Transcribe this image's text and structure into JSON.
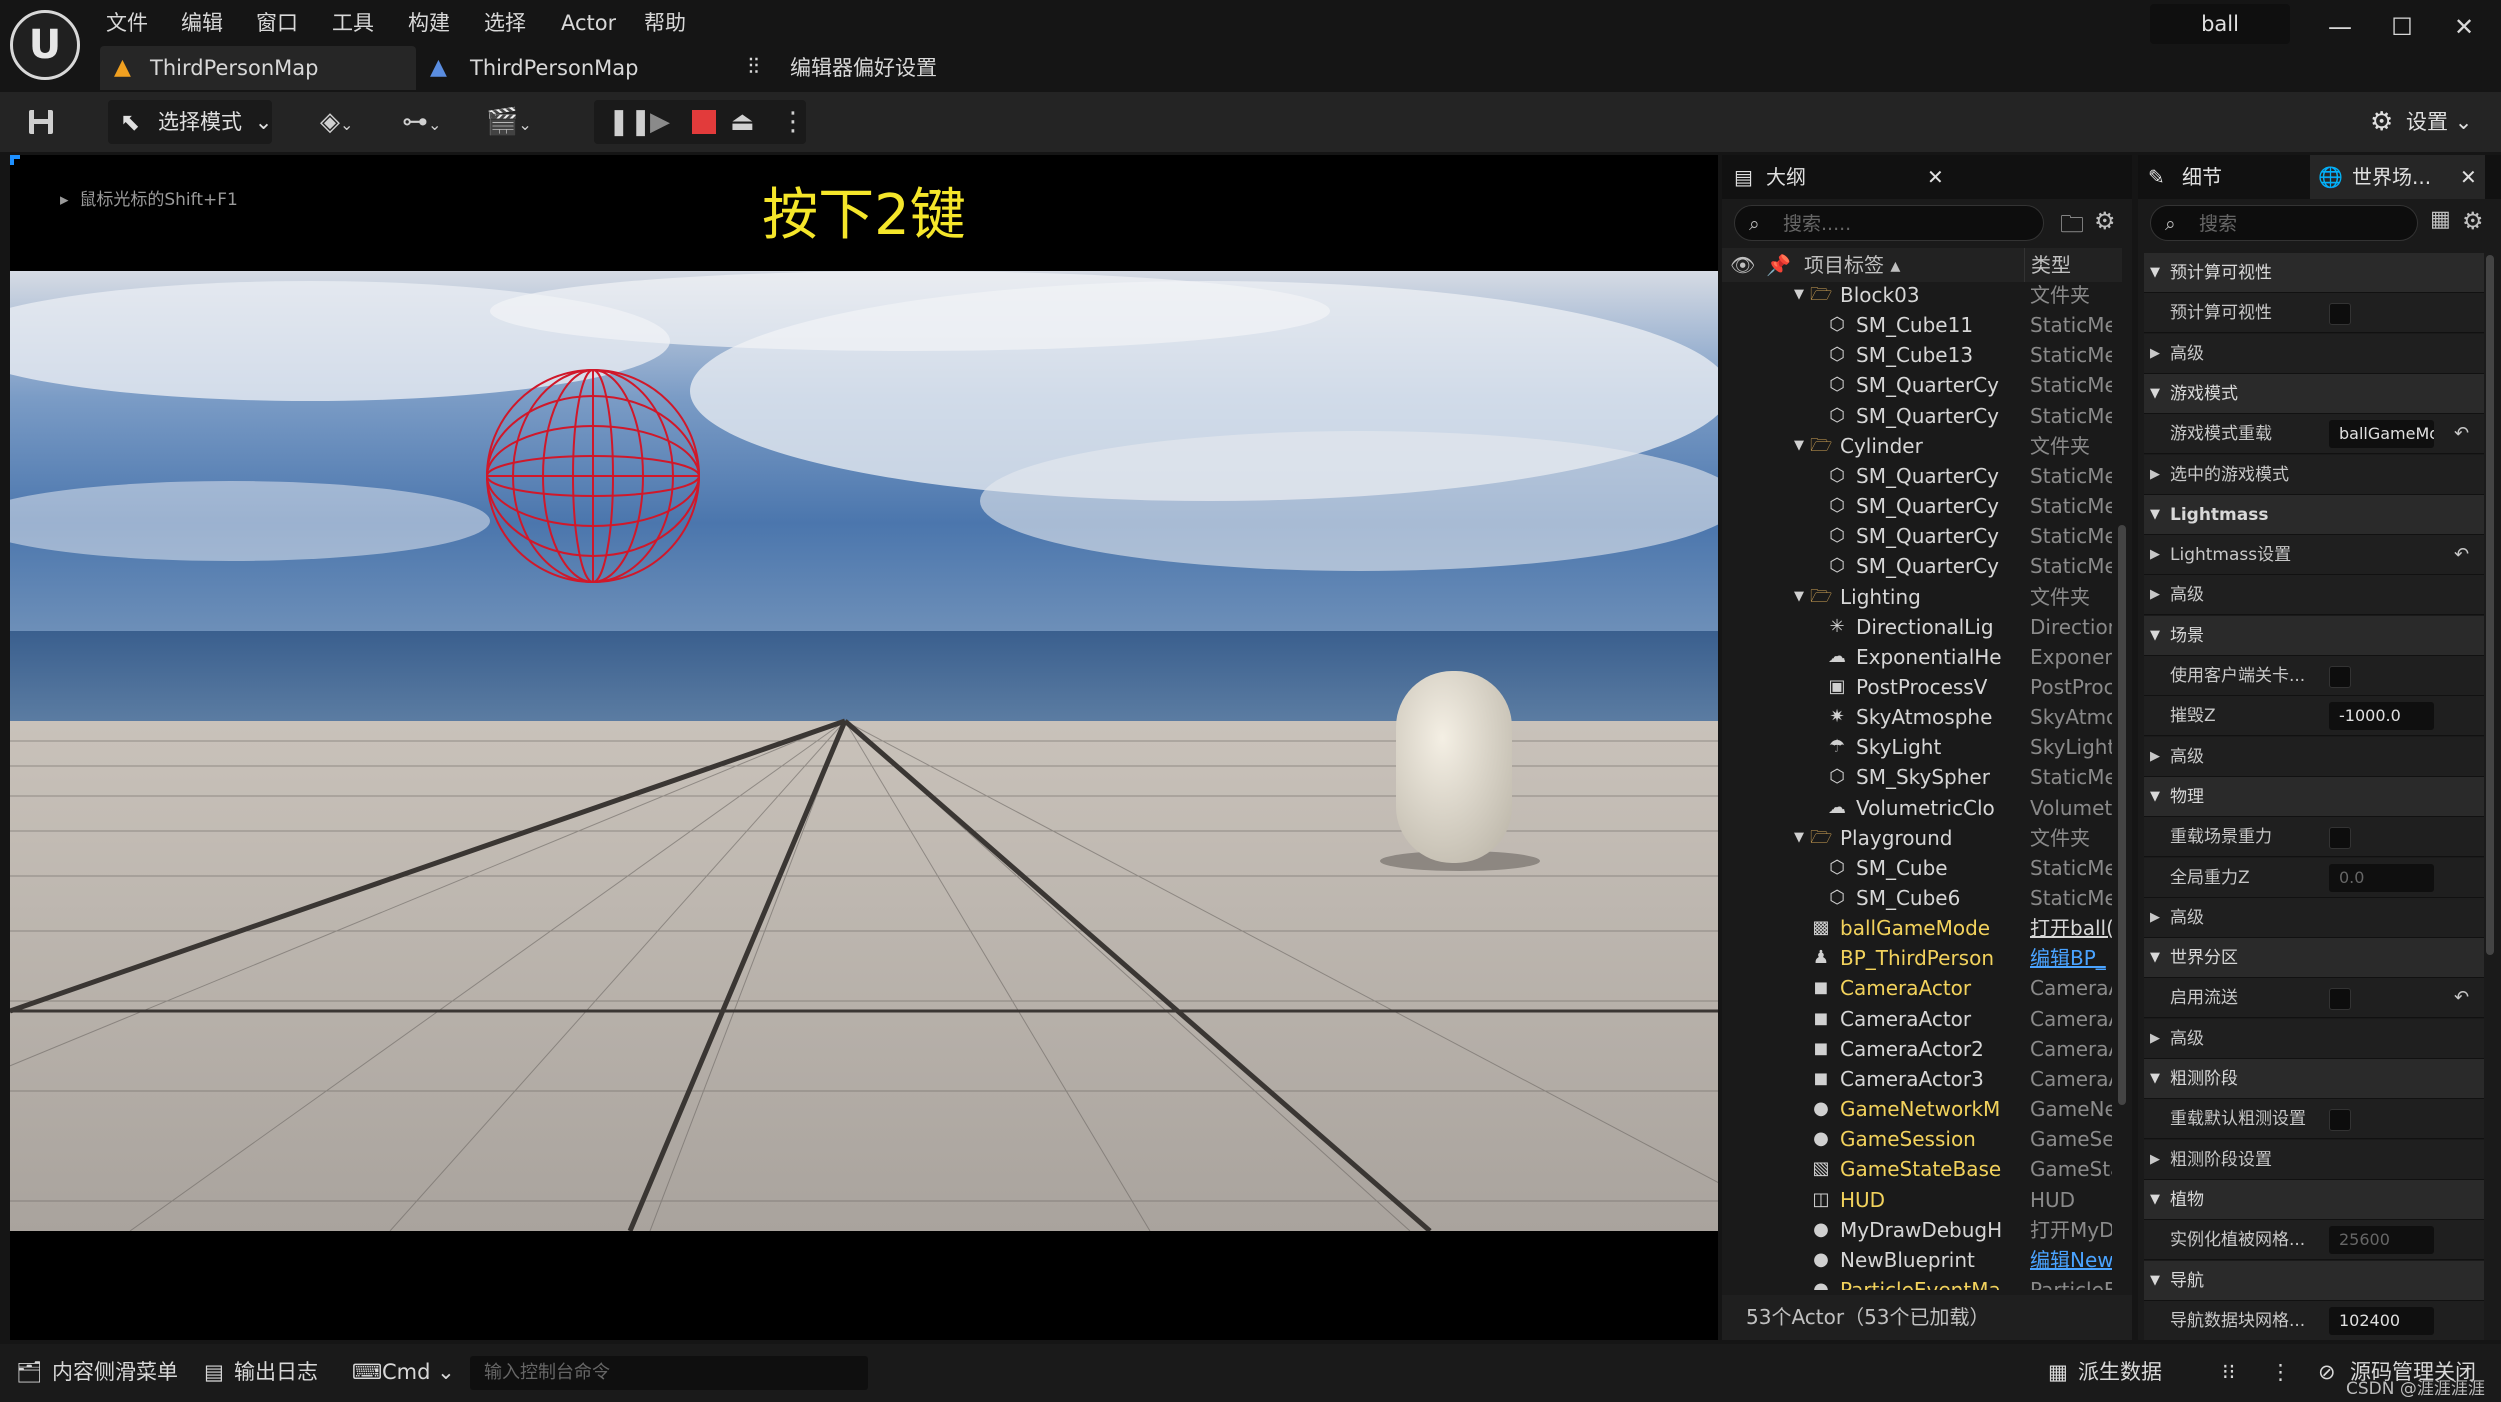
{
  "menu": [
    "文件",
    "编辑",
    "窗口",
    "工具",
    "构建",
    "选择",
    "Actor",
    "帮助"
  ],
  "logo": "U",
  "tabs": [
    "ThirdPersonMap",
    "ThirdPersonMap",
    "编辑器偏好设置"
  ],
  "project_name": "ball",
  "window_controls": [
    "—",
    "☐",
    "✕"
  ],
  "toolbar": {
    "select_mode": "选择模式",
    "settings": "设置"
  },
  "viewport": {
    "hint": "鼠标光标的Shift+F1",
    "overlay_text": "按下2键"
  },
  "outliner": {
    "title": "大纲",
    "search_placeholder": "搜索.....",
    "col_label": "项目标签 ▴",
    "col_type": "类型",
    "rows": [
      {
        "name": "Block03",
        "type": "文件夹",
        "icon": "folder",
        "indent": 1,
        "expand": true
      },
      {
        "name": "SM_Cube11",
        "type": "StaticMe",
        "icon": "mesh",
        "indent": 2
      },
      {
        "name": "SM_Cube13",
        "type": "StaticMe",
        "icon": "mesh",
        "indent": 2
      },
      {
        "name": "SM_QuarterCy",
        "type": "StaticMe",
        "icon": "mesh",
        "indent": 2
      },
      {
        "name": "SM_QuarterCy",
        "type": "StaticMe",
        "icon": "mesh",
        "indent": 2
      },
      {
        "name": "Cylinder",
        "type": "文件夹",
        "icon": "folder",
        "indent": 1,
        "expand": true
      },
      {
        "name": "SM_QuarterCy",
        "type": "StaticMe",
        "icon": "mesh",
        "indent": 2
      },
      {
        "name": "SM_QuarterCy",
        "type": "StaticMe",
        "icon": "mesh",
        "indent": 2
      },
      {
        "name": "SM_QuarterCy",
        "type": "StaticMe",
        "icon": "mesh",
        "indent": 2
      },
      {
        "name": "SM_QuarterCy",
        "type": "StaticMe",
        "icon": "mesh",
        "indent": 2
      },
      {
        "name": "Lighting",
        "type": "文件夹",
        "icon": "folder",
        "indent": 1,
        "expand": true
      },
      {
        "name": "DirectionalLig",
        "type": "Direction",
        "icon": "light",
        "indent": 2
      },
      {
        "name": "ExponentialHe",
        "type": "Exponent",
        "icon": "fog",
        "indent": 2
      },
      {
        "name": "PostProcessV",
        "type": "PostProc",
        "icon": "volume",
        "indent": 2
      },
      {
        "name": "SkyAtmosphe",
        "type": "SkyAtmo",
        "icon": "sky",
        "indent": 2
      },
      {
        "name": "SkyLight",
        "type": "SkyLight",
        "icon": "skylight",
        "indent": 2
      },
      {
        "name": "SM_SkySpher",
        "type": "StaticMe",
        "icon": "mesh",
        "indent": 2
      },
      {
        "name": "VolumetricClo",
        "type": "Volumetr",
        "icon": "cloud",
        "indent": 2
      },
      {
        "name": "Playground",
        "type": "文件夹",
        "icon": "folder",
        "indent": 1,
        "expand": true
      },
      {
        "name": "SM_Cube",
        "type": "StaticMe",
        "icon": "mesh",
        "indent": 2
      },
      {
        "name": "SM_Cube6",
        "type": "StaticMe",
        "icon": "mesh",
        "indent": 2
      },
      {
        "name": "ballGameMode",
        "type": "打开ball(",
        "icon": "gamemode",
        "indent": 1,
        "highlight": true
      },
      {
        "name": "BP_ThirdPerson",
        "type": "编辑BP_",
        "icon": "pawn",
        "indent": 1,
        "highlight": true,
        "link": true
      },
      {
        "name": "CameraActor",
        "type": "CameraA",
        "icon": "camera",
        "indent": 1,
        "highlight": true
      },
      {
        "name": "CameraActor",
        "type": "CameraA",
        "icon": "camera",
        "indent": 1
      },
      {
        "name": "CameraActor2",
        "type": "CameraA",
        "icon": "camera",
        "indent": 1
      },
      {
        "name": "CameraActor3",
        "type": "CameraA",
        "icon": "camera",
        "indent": 1
      },
      {
        "name": "GameNetworkM",
        "type": "GameNe",
        "icon": "sphere",
        "indent": 1,
        "highlight": true
      },
      {
        "name": "GameSession",
        "type": "GameSes",
        "icon": "sphere",
        "indent": 1,
        "highlight": true
      },
      {
        "name": "GameStateBase",
        "type": "GameSta",
        "icon": "state",
        "indent": 1,
        "highlight": true
      },
      {
        "name": "HUD",
        "type": "HUD",
        "icon": "hud",
        "indent": 1,
        "highlight": true
      },
      {
        "name": "MyDrawDebugH",
        "type": "打开MyD",
        "icon": "sphere",
        "indent": 1
      },
      {
        "name": "NewBlueprint",
        "type": "编辑New",
        "icon": "sphere",
        "indent": 1,
        "link": true
      },
      {
        "name": "ParticleEventMa",
        "type": "ParticleE",
        "icon": "sphere",
        "indent": 1,
        "highlight": true
      }
    ],
    "footer": "53个Actor（53个已加载）"
  },
  "details": {
    "tab1": "细节",
    "tab2": "世界场...",
    "search_placeholder": "搜索",
    "rows": [
      {
        "kind": "section",
        "label": "预计算可视性",
        "open": true
      },
      {
        "kind": "check",
        "label": "预计算可视性"
      },
      {
        "kind": "sub",
        "label": "高级"
      },
      {
        "kind": "section",
        "label": "游戏模式",
        "open": true
      },
      {
        "kind": "value",
        "label": "游戏模式重载",
        "value": "ballGameMode",
        "reset": true
      },
      {
        "kind": "sub",
        "label": "选中的游戏模式"
      },
      {
        "kind": "section",
        "label": "Lightmass",
        "open": true,
        "bold": true
      },
      {
        "kind": "sub",
        "label": "Lightmass设置",
        "reset": true
      },
      {
        "kind": "sub",
        "label": "高级"
      },
      {
        "kind": "section",
        "label": "场景",
        "open": true
      },
      {
        "kind": "check",
        "label": "使用客户端关卡..."
      },
      {
        "kind": "value",
        "label": "摧毁Z",
        "value": "-1000.0"
      },
      {
        "kind": "sub",
        "label": "高级"
      },
      {
        "kind": "section",
        "label": "物理",
        "open": true
      },
      {
        "kind": "check",
        "label": "重载场景重力"
      },
      {
        "kind": "value",
        "label": "全局重力Z",
        "value": "0.0",
        "dim": true
      },
      {
        "kind": "sub",
        "label": "高级"
      },
      {
        "kind": "section",
        "label": "世界分区",
        "open": true
      },
      {
        "kind": "check",
        "label": "启用流送",
        "reset": true
      },
      {
        "kind": "sub",
        "label": "高级"
      },
      {
        "kind": "section",
        "label": "粗测阶段",
        "open": true
      },
      {
        "kind": "check",
        "label": "重载默认粗测设置"
      },
      {
        "kind": "sub",
        "label": "粗测阶段设置"
      },
      {
        "kind": "section",
        "label": "植物",
        "open": true
      },
      {
        "kind": "value",
        "label": "实例化植被网格...",
        "value": "25600",
        "dim": true
      },
      {
        "kind": "section",
        "label": "导航",
        "open": true
      },
      {
        "kind": "value",
        "label": "导航数据块网格...",
        "value": "102400"
      }
    ]
  },
  "statusbar": {
    "content_drawer": "内容侧滑菜单",
    "output_log": "输出日志",
    "cmd": "Cmd",
    "console_placeholder": "输入控制台命令",
    "derived_data": "派生数据",
    "source_control": "源码管理关闭",
    "watermark": "CSDN @涯涯涯涯"
  },
  "colors": {
    "accent": "#f5e62a",
    "link": "#4aa3ff",
    "folder": "#d4a656",
    "stop": "#e23b3b"
  }
}
